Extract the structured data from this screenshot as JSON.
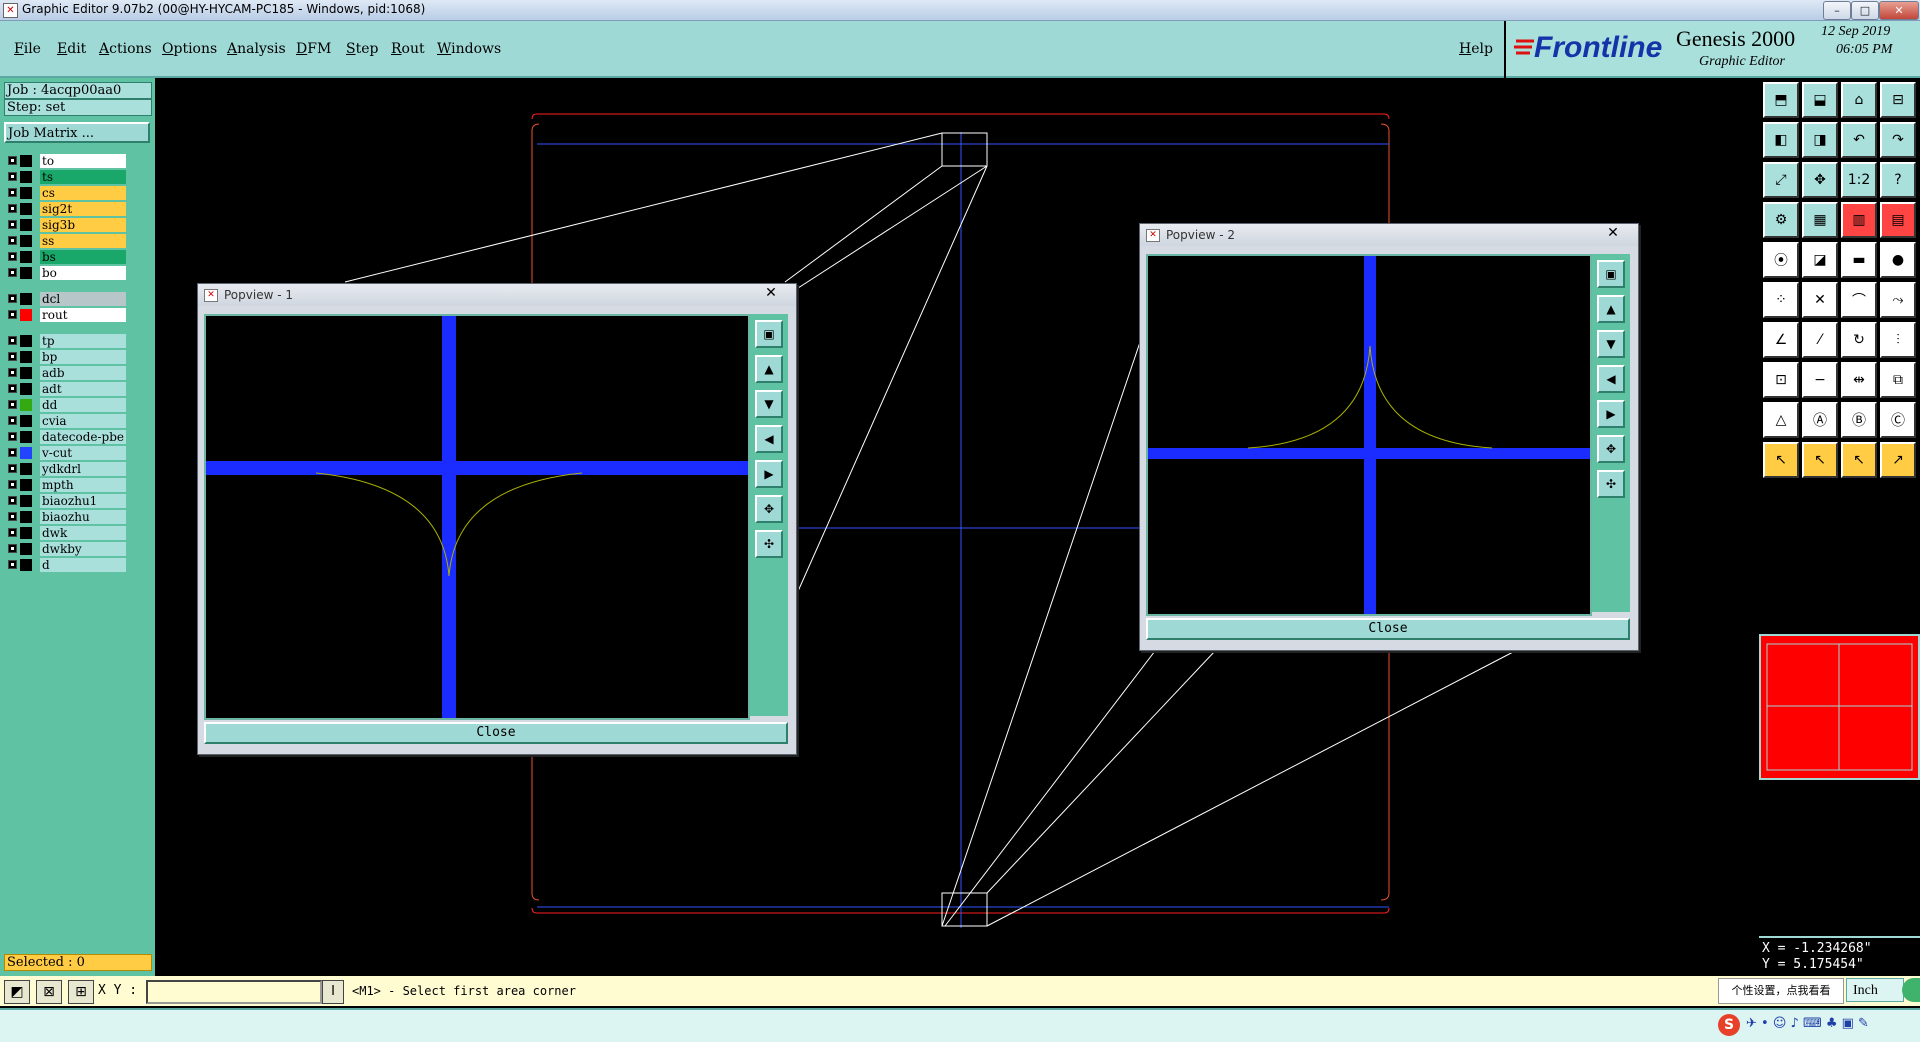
{
  "window": {
    "title": "Graphic Editor 9.07b2 (00@HY-HYCAM-PC185 - Windows, pid:1068)",
    "min_label": "–",
    "max_label": "□",
    "close_label": "✕"
  },
  "menu": {
    "items": [
      "File",
      "Edit",
      "Actions",
      "Options",
      "Analysis",
      "DFM",
      "Step",
      "Rout",
      "Windows"
    ],
    "help": "Help"
  },
  "logo": {
    "brand": "Frontline",
    "product": "Genesis 2000",
    "subtitle": "Graphic Editor",
    "date": "12 Sep 2019",
    "time": "06:05 PM"
  },
  "left": {
    "job": "Job : 4acqp00aa0",
    "step": "Step: set",
    "matrix_button": "Job Matrix ...",
    "selected": "Selected : 0"
  },
  "layers": [
    {
      "name": "to",
      "swatch": "#000000",
      "bg": "#ffffff"
    },
    {
      "name": "ts",
      "swatch": "#000000",
      "bg": "#1aa86a"
    },
    {
      "name": "cs",
      "swatch": "#000000",
      "bg": "#ffcc44"
    },
    {
      "name": "sig2t",
      "swatch": "#000000",
      "bg": "#ffcc44"
    },
    {
      "name": "sig3b",
      "swatch": "#000000",
      "bg": "#ffcc44"
    },
    {
      "name": "ss",
      "swatch": "#000000",
      "bg": "#ffcc44"
    },
    {
      "name": "bs",
      "swatch": "#000000",
      "bg": "#1aa86a"
    },
    {
      "name": "bo",
      "swatch": "#000000",
      "bg": "#ffffff"
    },
    {
      "name": "dcl",
      "swatch": "#000000",
      "bg": "#b7c6c8"
    },
    {
      "name": "rout",
      "swatch": "#ff0000",
      "bg": "#ffffff"
    },
    {
      "name": "tp",
      "swatch": "#000000",
      "bg": "#a9e0dc"
    },
    {
      "name": "bp",
      "swatch": "#000000",
      "bg": "#a9e0dc"
    },
    {
      "name": "adb",
      "swatch": "#000000",
      "bg": "#a9e0dc"
    },
    {
      "name": "adt",
      "swatch": "#000000",
      "bg": "#a9e0dc"
    },
    {
      "name": "dd",
      "swatch": "#33aa11",
      "bg": "#a9e0dc"
    },
    {
      "name": "cvia",
      "swatch": "#000000",
      "bg": "#a9e0dc"
    },
    {
      "name": "datecode-pbe",
      "swatch": "#000000",
      "bg": "#a9e0dc"
    },
    {
      "name": "v-cut",
      "swatch": "#2244ff",
      "bg": "#a9e0dc"
    },
    {
      "name": "ydkdrl",
      "swatch": "#000000",
      "bg": "#a9e0dc"
    },
    {
      "name": "mpth",
      "swatch": "#000000",
      "bg": "#a9e0dc"
    },
    {
      "name": "biaozhu1",
      "swatch": "#000000",
      "bg": "#a9e0dc"
    },
    {
      "name": "biaozhu",
      "swatch": "#000000",
      "bg": "#a9e0dc"
    },
    {
      "name": "dwk",
      "swatch": "#000000",
      "bg": "#a9e0dc"
    },
    {
      "name": "dwkby",
      "swatch": "#000000",
      "bg": "#a9e0dc"
    },
    {
      "name": "d",
      "swatch": "#000000",
      "bg": "#a9e0dc"
    }
  ],
  "popview1": {
    "title": "Popview - 1",
    "close": "Close",
    "x": "✕"
  },
  "popview2": {
    "title": "Popview - 2",
    "close": "Close",
    "x": "✕"
  },
  "toolbar_icons": [
    "open-step-icon",
    "save-icon",
    "home-icon",
    "window-icon",
    "zoom-prev-icon",
    "zoom-next-icon",
    "undo-icon",
    "redo-icon",
    "zoom-fit-icon",
    "pan-icon",
    "scale-1-2-icon",
    "help-icon",
    "snap-icon",
    "grid-icon",
    "profile-icon",
    "features-icon",
    "measure-icon",
    "highlight-icon",
    "ruler-icon",
    "pad-icon",
    "connect-icon",
    "cross-icon",
    "arc-icon",
    "link-icon",
    "line-icon",
    "slash-icon",
    "rotate-icon",
    "split-icon",
    "pad-add-icon",
    "minus-icon",
    "move-icon",
    "shapes-icon",
    "triangle-icon",
    "triangle-a-icon",
    "triangle-b-icon",
    "triangle-c-icon",
    "pointer-icon",
    "pointer-select-icon",
    "pointer-edit-icon",
    "route-icon"
  ],
  "bottom": {
    "xy_label": "X Y :",
    "xy_value": "",
    "prompt": "<M1> - Select first area corner",
    "ime_tip": "个性设置，点我看看",
    "units": "Inch"
  },
  "coords": {
    "x": "X = -1.234268\"",
    "y": "Y =  5.175454\""
  },
  "colors": {
    "menu_bg": "#9fd9d6",
    "panel_green": "#5ec2a3",
    "vcut_blue": "#1a2cff",
    "rout_red": "#ff2020",
    "outline": "#ffffff"
  }
}
